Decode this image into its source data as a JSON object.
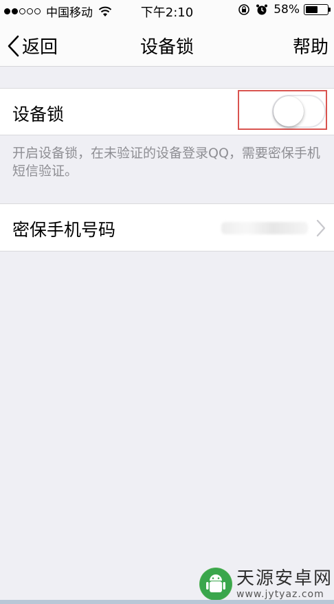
{
  "status_bar": {
    "carrier": "中国移动",
    "time": "下午2:10",
    "battery_percent": "58%",
    "battery_level": 0.58,
    "signal_strength": 2,
    "signal_total": 5
  },
  "nav": {
    "back_label": "返回",
    "title": "设备锁",
    "help_label": "帮助"
  },
  "device_lock": {
    "label": "设备锁",
    "enabled": false,
    "description": "开启设备锁，在未验证的设备登录QQ，需要密保手机短信验证。"
  },
  "security_phone": {
    "label": "密保手机号码"
  },
  "watermark": {
    "title": "天源安卓网",
    "url": "www.jytyaz.com"
  },
  "colors": {
    "background": "#efeff4",
    "highlight_border": "#d9534f",
    "description_text": "#8e8e93"
  }
}
